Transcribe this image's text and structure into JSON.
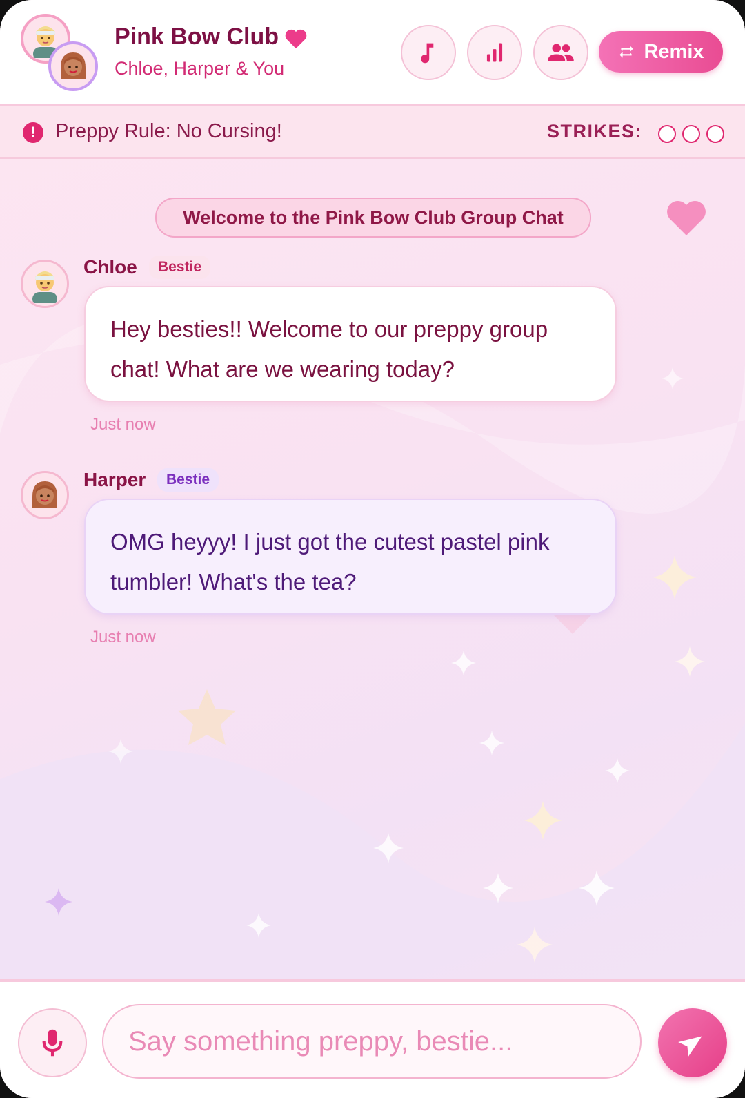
{
  "header": {
    "title": "Pink Bow Club",
    "subtitle": "Chloe, Harper & You",
    "actions": {
      "music_icon": "music-note-icon",
      "stats_icon": "bar-chart-icon",
      "members_icon": "group-icon",
      "remix_label": "Remix"
    }
  },
  "rule_bar": {
    "rule_text": "Preppy Rule: No Cursing!",
    "strikes_label": "STRIKES:",
    "strikes_used": 0,
    "strikes_total": 3
  },
  "chat": {
    "welcome_banner": "Welcome to the Pink Bow Club Group Chat",
    "messages": [
      {
        "sender": "Chloe",
        "badge": "Bestie",
        "text": "Hey besties!! Welcome to our preppy group chat! What are we wearing today?",
        "time": "Just now"
      },
      {
        "sender": "Harper",
        "badge": "Bestie",
        "text": "OMG heyyy! I just got the cutest pastel pink tumbler! What's the tea?",
        "time": "Just now"
      }
    ]
  },
  "composer": {
    "placeholder": "Say something preppy, bestie...",
    "value": ""
  },
  "colors": {
    "accent": "#e94c93",
    "title": "#7d1044",
    "background": "#fde6f1"
  }
}
